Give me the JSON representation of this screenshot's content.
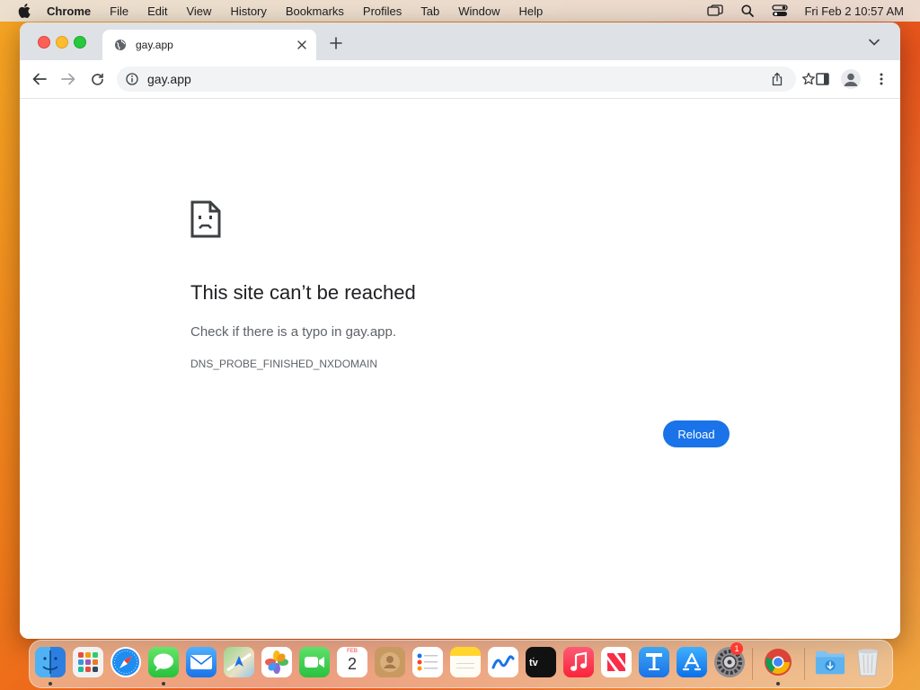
{
  "menubar": {
    "app_name": "Chrome",
    "items": [
      "File",
      "Edit",
      "View",
      "History",
      "Bookmarks",
      "Profiles",
      "Tab",
      "Window",
      "Help"
    ],
    "clock": "Fri Feb 2  10:57 AM",
    "icons": [
      "apple-icon",
      "screen-mirroring-icon",
      "spotlight-search-icon",
      "control-center-icon"
    ]
  },
  "browser": {
    "tab": {
      "title": "gay.app",
      "favicon": "globe-icon"
    },
    "omnibox": {
      "url": "gay.app",
      "security_icon": "info-icon"
    }
  },
  "error_page": {
    "icon": "sad-document-icon",
    "title": "This site can’t be reached",
    "message": "Check if there is a typo in gay.app.",
    "code": "DNS_PROBE_FINISHED_NXDOMAIN",
    "reload_label": "Reload"
  },
  "dock": {
    "calendar": {
      "month": "FEB",
      "day": "2"
    },
    "settings_badge": "1",
    "apps": [
      "Finder",
      "Launchpad",
      "Safari",
      "Messages",
      "Mail",
      "Maps",
      "Photos",
      "FaceTime",
      "Calendar",
      "Contacts",
      "Reminders",
      "Notes",
      "Freeform",
      "TV",
      "Music",
      "News",
      "Keynote",
      "App Store",
      "System Settings",
      "Google Chrome",
      "Downloads",
      "Trash"
    ]
  },
  "colors": {
    "accent": "#1a73e8",
    "tabstrip": "#dee1e6",
    "text_primary": "#202124",
    "text_secondary": "#5f6368"
  }
}
